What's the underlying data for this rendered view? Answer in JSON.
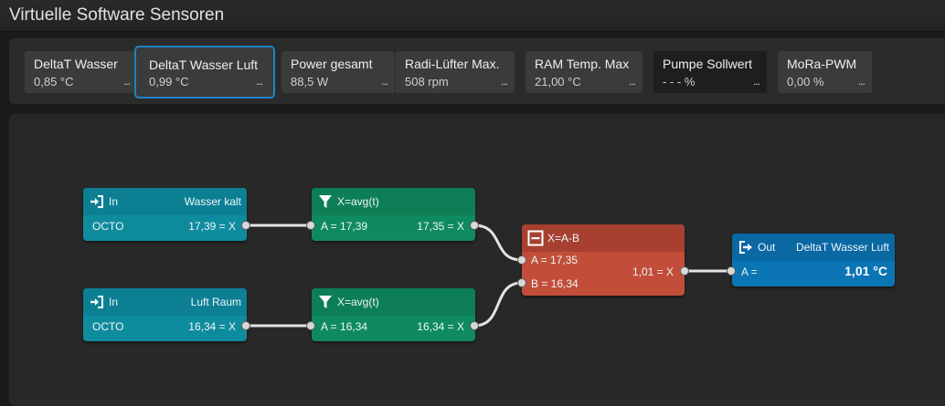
{
  "window": {
    "title": "Virtuelle Software Sensoren"
  },
  "tiles": [
    {
      "name": "DeltaT Wasser",
      "value": "0,85 °C",
      "more": "..."
    },
    {
      "name": "DeltaT Wasser Luft",
      "value": "0,99 °C",
      "more": "...",
      "selected": true
    },
    {
      "name": "Power gesamt",
      "value": "88,5 W",
      "more": "..."
    },
    {
      "name": "Radi-Lüfter Max.",
      "value": "508 rpm",
      "more": "..."
    },
    {
      "name": "RAM Temp. Max",
      "value": "21,00 °C",
      "more": "..."
    },
    {
      "name": "Pumpe Sollwert",
      "value": "- - - %",
      "more": "..."
    },
    {
      "name": "MoRa-PWM",
      "value": "0,00 %",
      "more": "..."
    }
  ],
  "nodes": {
    "in1": {
      "type": "In",
      "label": "Wasser kalt",
      "source": "OCTO",
      "output": "17,39 = X",
      "icon": "input-arrow-icon"
    },
    "in2": {
      "type": "In",
      "label": "Luft Raum",
      "source": "OCTO",
      "output": "16,34 = X",
      "icon": "input-arrow-icon"
    },
    "f1": {
      "title": "X=avg(t)",
      "input": "A = 17,39",
      "output": "17,35 = X",
      "icon": "filter-icon"
    },
    "f2": {
      "title": "X=avg(t)",
      "input": "A = 16,34",
      "output": "16,34 = X",
      "icon": "filter-icon"
    },
    "sub": {
      "title": "X=A-B",
      "input_a": "A = 17,35",
      "input_b": "B = 16,34",
      "output": "1,01 = X",
      "icon": "minus-box-icon"
    },
    "out": {
      "type": "Out",
      "label": "DeltaT Wasser Luft",
      "input": "A =",
      "value": "1,01 °C",
      "icon": "output-arrow-icon"
    }
  },
  "colors": {
    "input_node": "#0f8b9e",
    "filter_node": "#0f8a5e",
    "operator_node": "#c24e3a",
    "output_node": "#0b75b3",
    "selection": "#1f82c6"
  }
}
